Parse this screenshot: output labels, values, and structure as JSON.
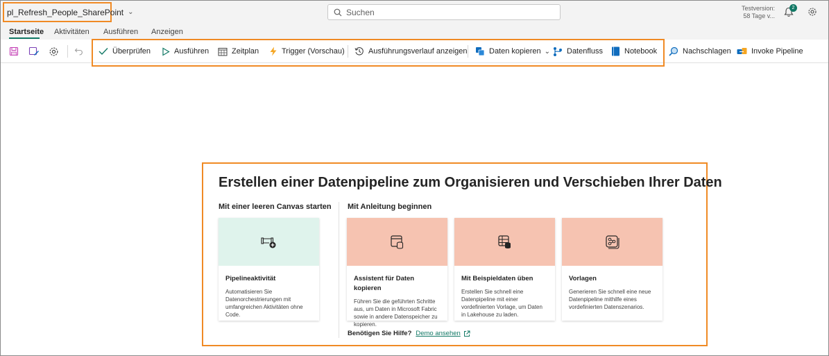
{
  "header": {
    "pipeline_name": "pl_Refresh_People_SharePoint",
    "search_placeholder": "Suchen",
    "trial_line1": "Testversion:",
    "trial_line2": "58 Tage v...",
    "notification_count": "2"
  },
  "tabs": [
    {
      "label": "Startseite",
      "active": true
    },
    {
      "label": "Aktivitäten",
      "active": false
    },
    {
      "label": "Ausführen",
      "active": false
    },
    {
      "label": "Anzeigen",
      "active": false
    }
  ],
  "toolbar": {
    "validate": "Überprüfen",
    "run": "Ausführen",
    "schedule": "Zeitplan",
    "trigger": "Trigger (Vorschau)",
    "run_history": "Ausführungsverlauf anzeigen",
    "copy_data": "Daten kopieren",
    "dataflow": "Datenfluss",
    "notebook": "Notebook",
    "lookup": "Nachschlagen",
    "invoke_pipeline": "Invoke Pipeline"
  },
  "main": {
    "title": "Erstellen einer Datenpipeline zum Organisieren und Verschieben Ihrer Daten",
    "empty_canvas_label": "Mit einer leeren Canvas starten",
    "guided_label": "Mit Anleitung beginnen",
    "cards": [
      {
        "title": "Pipelineaktivität",
        "desc": "Automatisieren Sie Datenorchestrierungen mit umfangreichen Aktivitäten ohne Code.",
        "color": "#dff3ec"
      },
      {
        "title": "Assistent für Daten kopieren",
        "desc": "Führen Sie die geführten Schritte aus, um Daten in Microsoft Fabric sowie in andere Datenspeicher zu kopieren.",
        "color": "#f6c3b1"
      },
      {
        "title": "Mit Beispieldaten üben",
        "desc": "Erstellen Sie schnell eine Datenpipeline mit einer vordefinierten Vorlage, um Daten in Lakehouse zu laden.",
        "color": "#f6c3b1"
      },
      {
        "title": "Vorlagen",
        "desc": "Generieren Sie schnell eine neue Datenpipeline mithilfe eines vordefinierten Datenszenarios.",
        "color": "#f6c3b1"
      }
    ],
    "help_question": "Benötigen Sie Hilfe?",
    "help_link": "Demo ansehen"
  },
  "colors": {
    "accent": "#117865",
    "highlight": "#f08a24"
  }
}
